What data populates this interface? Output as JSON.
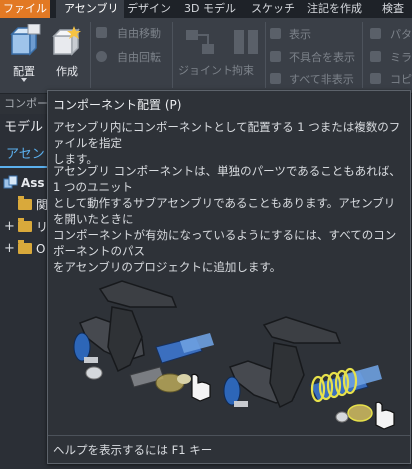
{
  "menu": {
    "tabs": [
      "ファイル",
      "アセンブリ",
      "デザイン",
      "3D モデル",
      "スケッチ",
      "注記を作成",
      "検査"
    ]
  },
  "ribbon": {
    "place_label": "配置",
    "create_label": "作成",
    "free_move": "自由移動",
    "free_rotate": "自由回転",
    "joint": "ジョイント",
    "constrain": "拘束",
    "show": "表示",
    "show_sick": "不具合を表示",
    "hide_all": "すべて非表示",
    "pattern": "パタ",
    "mirror": "ミラ",
    "copy": "コピ"
  },
  "panel": {
    "header": "コンポーネ",
    "model": "モデル",
    "tab": "アセン",
    "tree": [
      {
        "label": "Ass"
      },
      {
        "label": "関"
      },
      {
        "label": "リ"
      },
      {
        "label": "O"
      }
    ]
  },
  "tooltip": {
    "title": "コンポーネント配置 (P)",
    "lines1": [
      "アセンブリ内にコンポーネントとして配置する 1 つまたは複数のファイルを指定",
      "します。"
    ],
    "lines2": [
      "アセンブリ コンポーネントは、単独のパーツであることもあれば、1 つのユニット",
      "として動作するサブアセンブリであることもあります。アセンブリを開いたときに",
      "コンポーネントが有効になっているようにするには、すべてのコンポーネントのパス",
      "をアセンブリのプロジェクトに追加します。"
    ],
    "help": "ヘルプを表示するには F1 キー"
  },
  "colors": {
    "file_tab": "#e27924",
    "accent_blue": "#5bb0ee",
    "tooltip_bg": "#2e3238",
    "ribbon_bg": "#3a3f47"
  }
}
